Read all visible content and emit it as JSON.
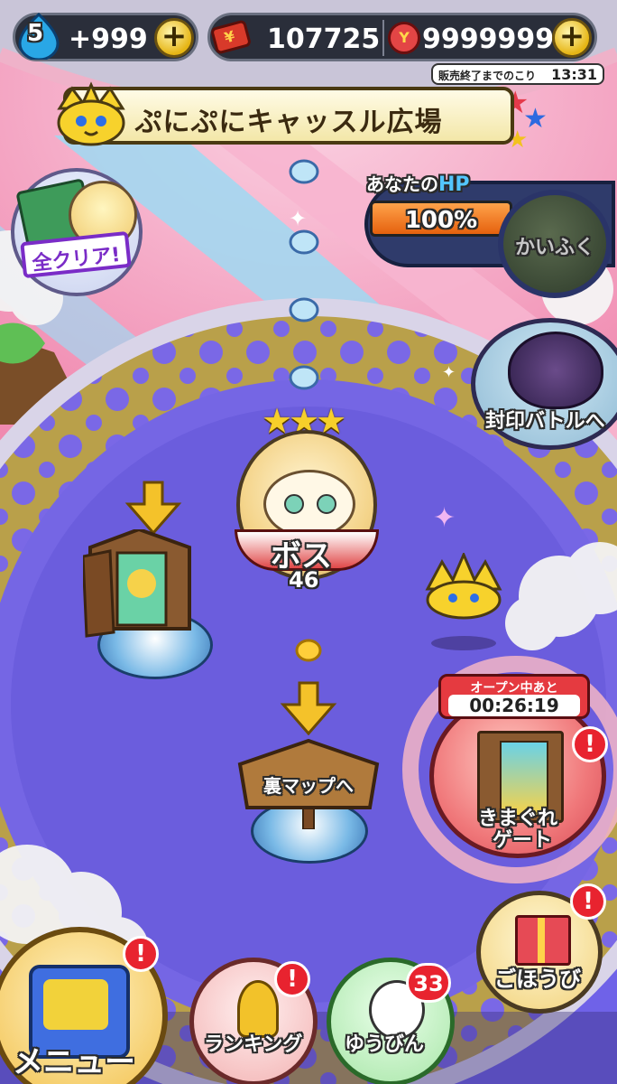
{
  "currency": {
    "stamina_level": "5",
    "stamina_value": "+999",
    "money": "107725",
    "ycoins": "9999999",
    "sale_timer_label": "販売終了までのこり",
    "sale_timer": "13:31"
  },
  "title": "ぷにぷにキャッスル広場",
  "hp": {
    "label_prefix": "あなたの",
    "label_hp": "HP",
    "percent": "100%",
    "value": 1.0,
    "heal_label": "かいふく"
  },
  "all_clear_label": "全クリア!",
  "seal_battle_label": "封印バトルへ",
  "boss": {
    "label": "ボス",
    "number": "46",
    "stars": 3
  },
  "ura_map_label": "裏マップへ",
  "gate": {
    "open_label": "オープン中あと",
    "timer": "00:26:19",
    "name_line1": "きまぐれ",
    "name_line2": "ゲート",
    "ring_text": "オープン中"
  },
  "reward_label": "ごほうび",
  "menu_label": "メニュー",
  "ranking_label": "ランキング",
  "mail_label": "ゆうびん",
  "mail_count": "33",
  "alert_mark": "!",
  "colors": {
    "field": "#6f62e8",
    "gold_ring": "#b9a04a",
    "badge_red": "#e8232f",
    "hp_orange": "#f07a1a"
  }
}
